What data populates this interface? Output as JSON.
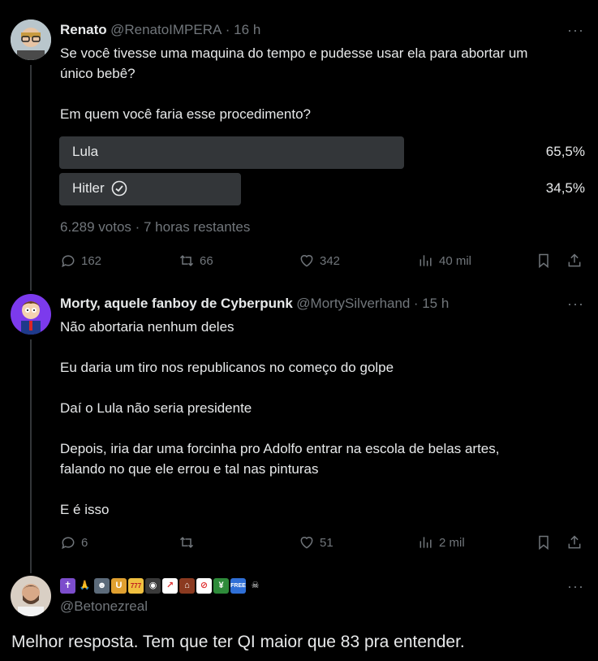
{
  "tweet1": {
    "name": "Renato",
    "handle": "@RenatoIMPERA",
    "time": "· 16 h",
    "text_line1": "Se você tivesse uma maquina do tempo e pudesse usar ela para abortar um",
    "text_line2": "único bebê?",
    "text_line3": "Em quem você faria esse procedimento?",
    "poll": {
      "options": [
        {
          "label": "Lula",
          "percent_text": "65,5%",
          "percent": 65.5,
          "color": "#333639"
        },
        {
          "label": "Hitler",
          "percent_text": "34,5%",
          "percent": 34.5,
          "color": "#333639",
          "selected": true
        }
      ],
      "footer": "6.289 votos · 7 horas restantes"
    },
    "actions": {
      "replies": "162",
      "retweets": "66",
      "likes": "342",
      "views": "40 mil"
    }
  },
  "tweet2": {
    "name": "Morty, aquele fanboy de Cyberpunk",
    "handle": "@MortySilverhand",
    "time": "· 15 h",
    "paragraphs": [
      "Não abortaria nenhum deles",
      "Eu daria um tiro nos republicanos no começo do golpe",
      "Daí o Lula não seria presidente",
      "Depois, iria dar uma forcinha pro Adolfo entrar na escola de belas artes,",
      "falando no que ele errou e tal nas pinturas",
      "E é isso"
    ],
    "actions": {
      "replies": "6",
      "retweets": "",
      "likes": "51",
      "views": "2 mil"
    }
  },
  "tweet3": {
    "handle": "@Betonezreal",
    "emoji_names": [
      "cross-emoji",
      "praying-hands-emoji",
      "robot-emoji",
      "beer-emoji",
      "slot-777-emoji",
      "gamepad-emoji",
      "chart-up-emoji",
      "house-emoji",
      "no-smoking-emoji",
      "yen-money-emoji",
      "free-emoji",
      "skull-crossbones-emoji"
    ],
    "free_label": "FREE",
    "text": "Melhor resposta. Tem que ter QI maior que 83 pra entender."
  },
  "more_glyph": "···"
}
